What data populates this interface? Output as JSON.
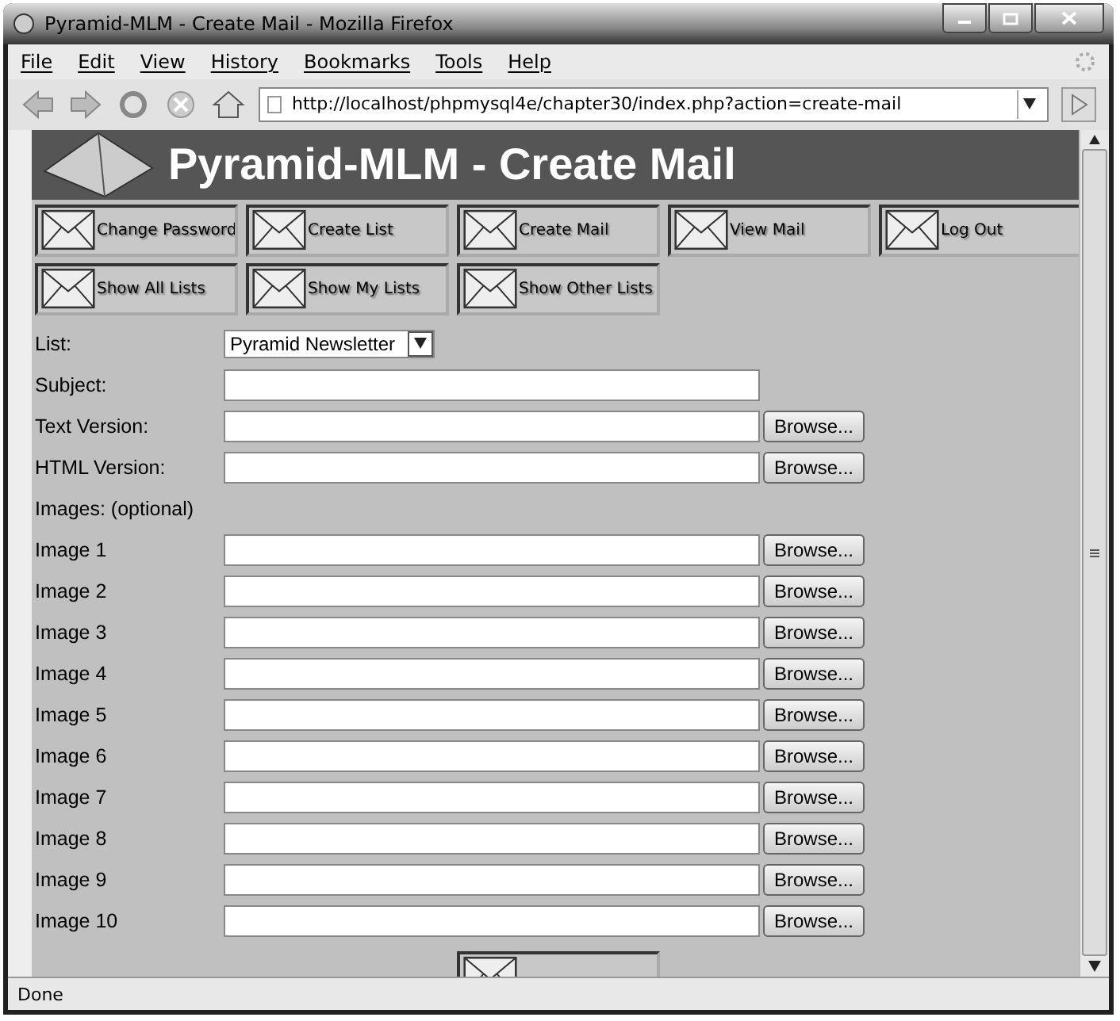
{
  "window": {
    "title": "Pyramid-MLM - Create Mail - Mozilla Firefox"
  },
  "menu": [
    "File",
    "Edit",
    "View",
    "History",
    "Bookmarks",
    "Tools",
    "Help"
  ],
  "address_bar": {
    "value": "http://localhost/phpmysql4e/chapter30/index.php?action=create-mail"
  },
  "page": {
    "title": "Pyramid-MLM - Create Mail",
    "nav_buttons": [
      "Change Password",
      "Create List",
      "Create Mail",
      "View Mail",
      "Log Out",
      "Show All Lists",
      "Show My Lists",
      "Show Other Lists"
    ],
    "form": [
      {
        "kind": "select",
        "label": "List:",
        "value": "Pyramid Newsletter"
      },
      {
        "kind": "text",
        "label": "Subject:"
      },
      {
        "kind": "file",
        "label": "Text Version:",
        "button": "Browse..."
      },
      {
        "kind": "file",
        "label": "HTML Version:",
        "button": "Browse..."
      },
      {
        "kind": "heading",
        "label": "Images: (optional)"
      },
      {
        "kind": "file",
        "label": "Image 1",
        "button": "Browse..."
      },
      {
        "kind": "file",
        "label": "Image 2",
        "button": "Browse..."
      },
      {
        "kind": "file",
        "label": "Image 3",
        "button": "Browse..."
      },
      {
        "kind": "file",
        "label": "Image 4",
        "button": "Browse..."
      },
      {
        "kind": "file",
        "label": "Image 5",
        "button": "Browse..."
      },
      {
        "kind": "file",
        "label": "Image 6",
        "button": "Browse..."
      },
      {
        "kind": "file",
        "label": "Image 7",
        "button": "Browse..."
      },
      {
        "kind": "file",
        "label": "Image 8",
        "button": "Browse..."
      },
      {
        "kind": "file",
        "label": "Image 9",
        "button": "Browse..."
      },
      {
        "kind": "file",
        "label": "Image 10",
        "button": "Browse..."
      }
    ]
  },
  "status_bar": {
    "text": "Done"
  }
}
